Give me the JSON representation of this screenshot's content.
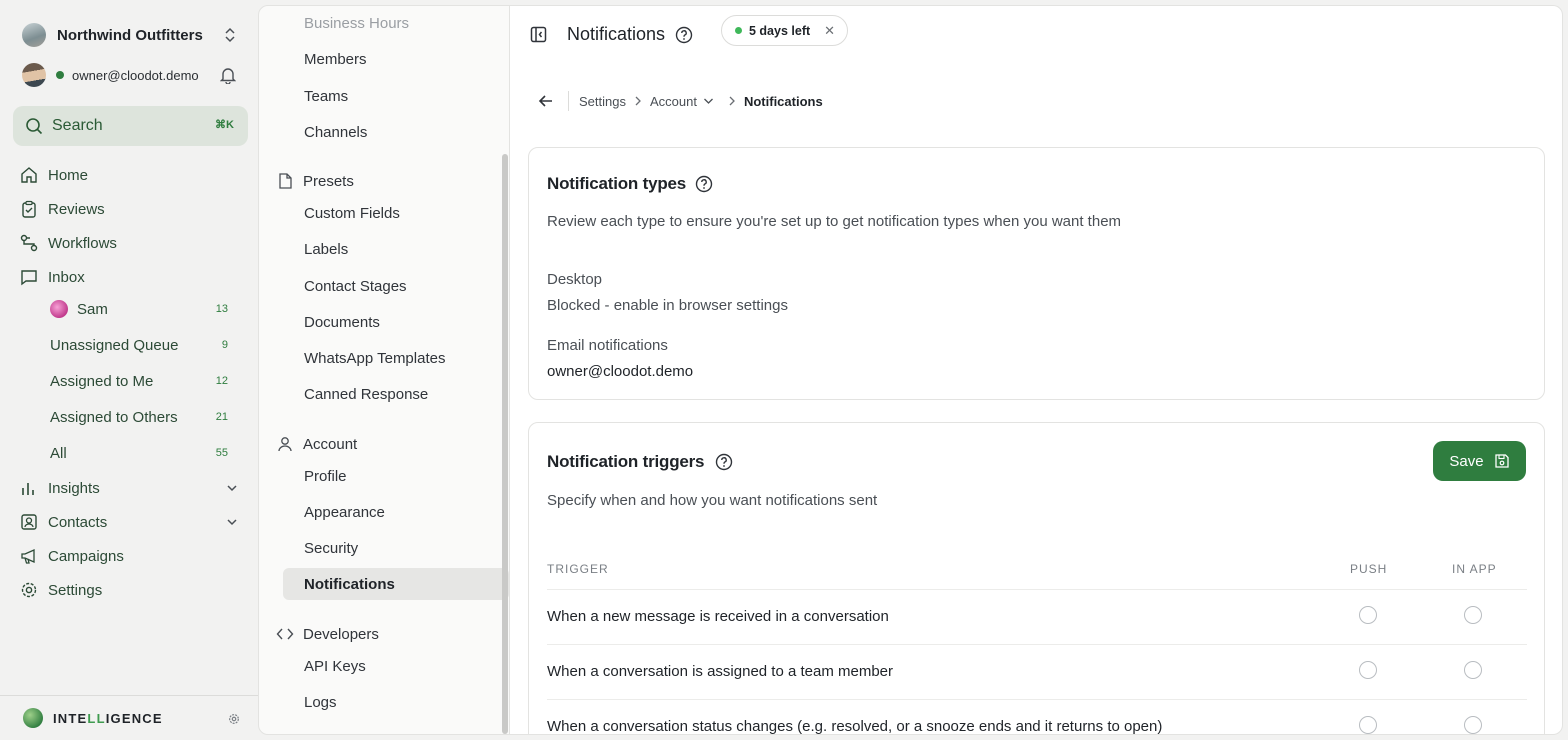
{
  "sidebar": {
    "org_name": "Northwind Outfitters",
    "user_email": "owner@cloodot.demo",
    "search": {
      "label": "Search",
      "shortcut": "⌘K"
    },
    "nav": [
      {
        "label": "Home",
        "icon": "home-icon"
      },
      {
        "label": "Reviews",
        "icon": "clipboard-icon"
      },
      {
        "label": "Workflows",
        "icon": "workflow-icon"
      },
      {
        "label": "Inbox",
        "icon": "chat-icon"
      }
    ],
    "inbox_items": [
      {
        "label": "Sam",
        "count": "13"
      },
      {
        "label": "Unassigned Queue",
        "count": "9"
      },
      {
        "label": "Assigned to Me",
        "count": "12"
      },
      {
        "label": "Assigned to Others",
        "count": "21"
      },
      {
        "label": "All",
        "count": "55"
      }
    ],
    "nav_lower": [
      {
        "label": "Insights",
        "icon": "bar-chart-icon"
      },
      {
        "label": "Contacts",
        "icon": "contact-card-icon"
      },
      {
        "label": "Campaigns",
        "icon": "megaphone-icon"
      },
      {
        "label": "Settings",
        "icon": "gear-icon"
      }
    ],
    "footer_brand_pre": "INTE",
    "footer_brand_hl": "LL",
    "footer_brand_post": "IGENCE"
  },
  "settings_nav": {
    "top_items": [
      "Business Hours",
      "Members",
      "Teams",
      "Channels"
    ],
    "presets": {
      "label": "Presets",
      "items": [
        "Custom Fields",
        "Labels",
        "Contact Stages",
        "Documents",
        "WhatsApp Templates",
        "Canned Response"
      ]
    },
    "account": {
      "label": "Account",
      "items": [
        "Profile",
        "Appearance",
        "Security",
        "Notifications"
      ]
    },
    "developers": {
      "label": "Developers",
      "items": [
        "API Keys",
        "Logs"
      ]
    }
  },
  "header": {
    "title": "Notifications",
    "trial_label": "5 days left",
    "trial_close": "✕"
  },
  "breadcrumb": {
    "settings": "Settings",
    "account": "Account",
    "current": "Notifications"
  },
  "types_card": {
    "title": "Notification types",
    "description": "Review each type to ensure you're set up to get notification types when you want them",
    "desktop_label": "Desktop",
    "desktop_value": "Blocked - enable in browser settings",
    "email_label": "Email notifications",
    "email_value": "owner@cloodot.demo"
  },
  "triggers_card": {
    "title": "Notification triggers",
    "description": "Specify when and how you want notifications sent",
    "save_label": "Save",
    "columns": {
      "trigger": "TRIGGER",
      "push": "PUSH",
      "in_app": "IN APP"
    },
    "rows": [
      {
        "text": "When a new message is received in a conversation",
        "push": false,
        "in_app": false
      },
      {
        "text": "When a conversation is assigned to a team member",
        "push": false,
        "in_app": false
      },
      {
        "text": "When a conversation status changes (e.g. resolved, or a snooze ends and it returns to open)",
        "push": false,
        "in_app": false
      }
    ]
  },
  "colors": {
    "accent": "#2f7d3f",
    "online": "#3fb85a"
  }
}
